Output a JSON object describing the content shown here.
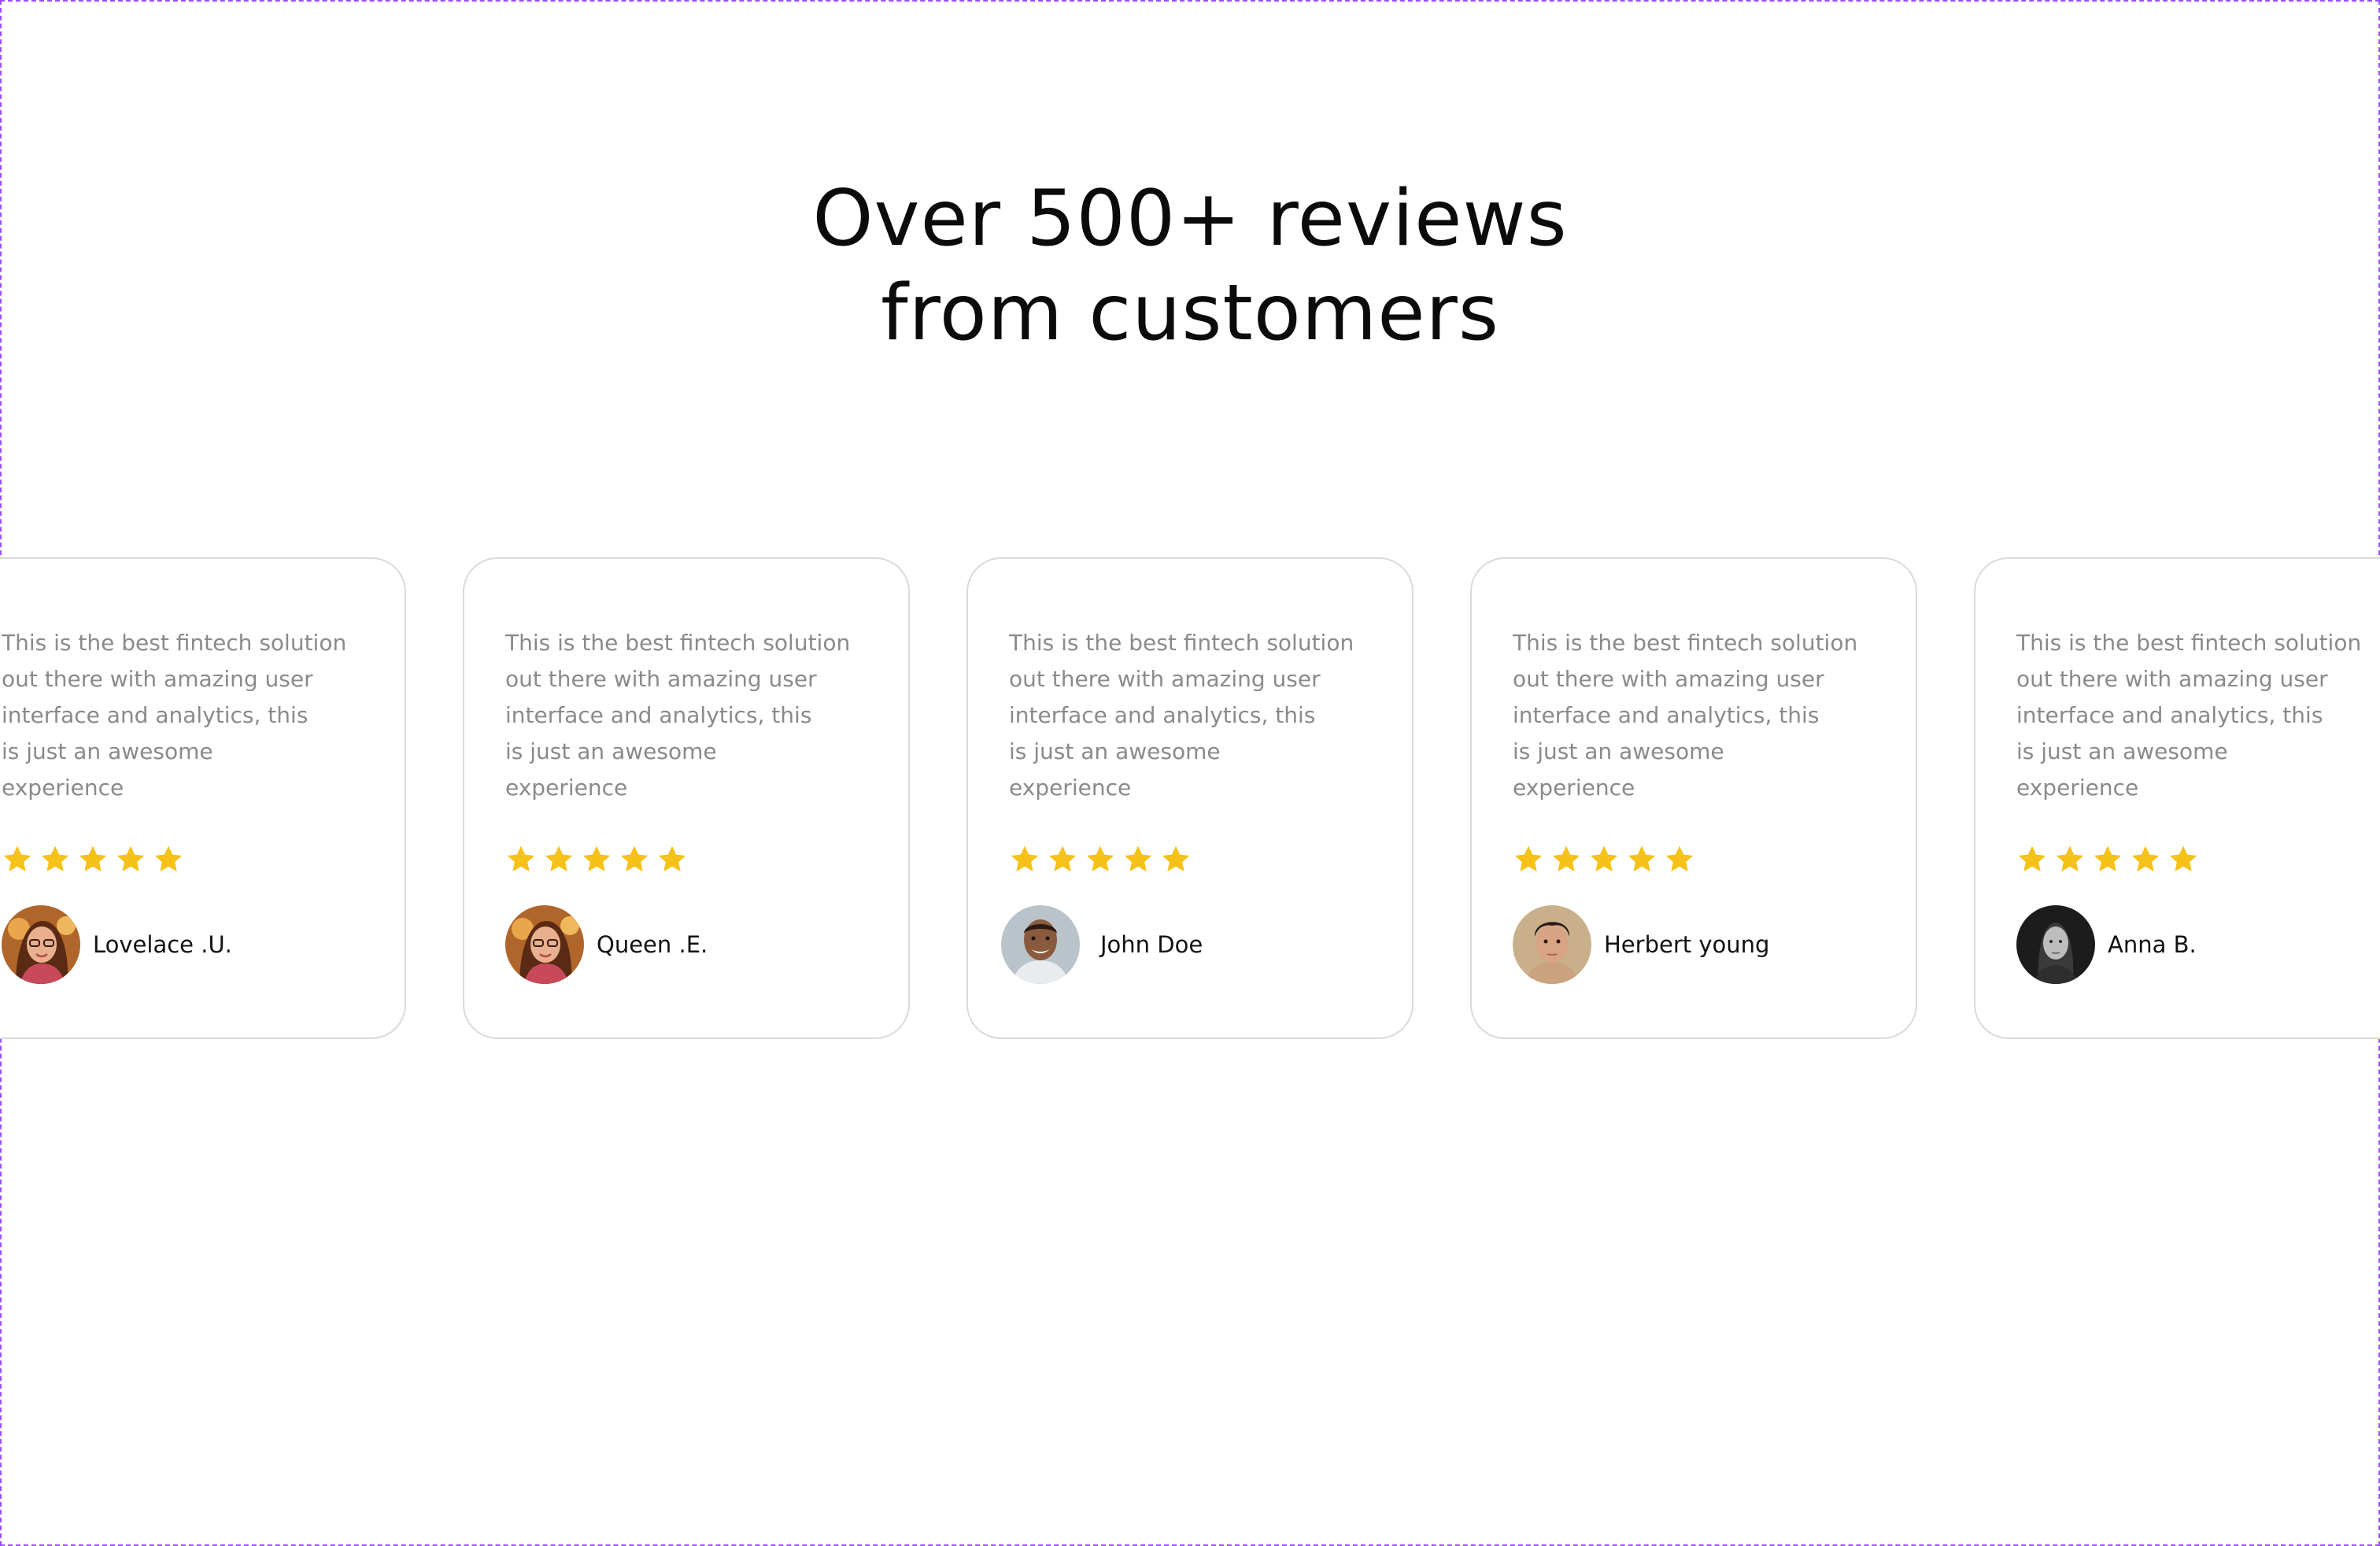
{
  "section": {
    "headline_line1": "Over 500+ reviews",
    "headline_line2": "from customers"
  },
  "colors": {
    "star": "#f6c118",
    "review_text": "#8a8a8a",
    "card_border": "#dadada",
    "frame": "#9b4dff"
  },
  "reviews": [
    {
      "text_lines": [
        "This is the best fintech solution",
        "out there with amazing user",
        "interface and analytics, this",
        "is just an awesome",
        "experience"
      ],
      "rating": 5,
      "name": "Lovelace .U.",
      "avatar_icon": "woman-with-glasses-avatar-icon"
    },
    {
      "text_lines": [
        "This is the best fintech solution",
        "out there with amazing user",
        "interface and analytics, this",
        "is just an awesome",
        "experience"
      ],
      "rating": 5,
      "name": "Queen .E.",
      "avatar_icon": "woman-with-glasses-avatar-icon"
    },
    {
      "text_lines": [
        "This is the best fintech solution",
        "out there with amazing user",
        "interface and analytics, this",
        "is just an awesome",
        "experience"
      ],
      "rating": 5,
      "name": "John Doe",
      "avatar_icon": "smiling-man-avatar-icon"
    },
    {
      "text_lines": [
        "This is the best fintech solution",
        "out there with amazing user",
        "interface and analytics, this",
        "is just an awesome",
        "experience"
      ],
      "rating": 5,
      "name": "Herbert young",
      "avatar_icon": "young-man-avatar-icon"
    },
    {
      "text_lines": [
        "This is the best fintech solution",
        "out there with amazing user",
        "interface and analytics, this",
        "is just an awesome",
        "experience"
      ],
      "rating": 5,
      "name": "Anna B.",
      "avatar_icon": "woman-monochrome-avatar-icon"
    }
  ]
}
